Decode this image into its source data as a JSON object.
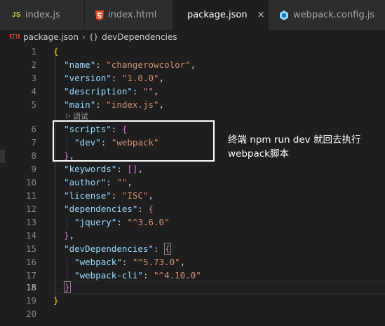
{
  "tabs": [
    {
      "label": "index.js",
      "icon": "js-file-icon",
      "active": false
    },
    {
      "label": "index.html",
      "icon": "html5-file-icon",
      "active": false
    },
    {
      "label": "package.json",
      "icon": "npm-package-icon",
      "active": true,
      "close_label": "×"
    },
    {
      "label": "webpack.config.js",
      "icon": "webpack-icon",
      "active": false
    }
  ],
  "breadcrumb": {
    "file": "package.json",
    "separator": "›",
    "object_icon": "{}",
    "symbol": "devDependencies"
  },
  "codelens": {
    "label": "调试",
    "icon": "play-icon"
  },
  "line_numbers": [
    "1",
    "2",
    "3",
    "4",
    "5",
    "6",
    "7",
    "8",
    "9",
    "10",
    "11",
    "12",
    "13",
    "14",
    "15",
    "16",
    "17",
    "18",
    "19",
    "20"
  ],
  "active_line": "18",
  "code": {
    "l1_brace": "{",
    "name_key": "\"name\"",
    "name_val": "\"changerowcolor\"",
    "version_key": "\"version\"",
    "version_val": "\"1.0.0\"",
    "description_key": "\"description\"",
    "description_val": "\"\"",
    "main_key": "\"main\"",
    "main_val": "\"index.js\"",
    "scripts_key": "\"scripts\"",
    "scripts_open": "{",
    "dev_key": "\"dev\"",
    "dev_val": "\"webpack\"",
    "scripts_close": "}",
    "keywords_key": "\"keywords\"",
    "keywords_val": "[]",
    "author_key": "\"author\"",
    "author_val": "\"\"",
    "license_key": "\"license\"",
    "license_val": "\"ISC\"",
    "dependencies_key": "\"dependencies\"",
    "dependencies_open": "{",
    "jquery_key": "\"jquery\"",
    "jquery_val": "\"^3.6.0\"",
    "dependencies_close": "}",
    "devdeps_key": "\"devDependencies\"",
    "devdeps_open": "{",
    "webpack_key": "\"webpack\"",
    "webpack_val": "\"^5.73.0\"",
    "webpackcli_key": "\"webpack-cli\"",
    "webpackcli_val": "\"^4.10.0\"",
    "devdeps_close": "}",
    "l19_brace": "}"
  },
  "annotation": {
    "line1": "终端 npm run dev 就回去执行",
    "line2": "webpack脚本",
    "box_color": "#ffffff"
  },
  "colors": {
    "json_key": "#9cdcfe",
    "json_string": "#ce9178",
    "brace_level1": "#ffd700",
    "brace_level2": "#da70d6",
    "editor_bg": "#1e1e1e",
    "tabbar_bg": "#252526"
  }
}
